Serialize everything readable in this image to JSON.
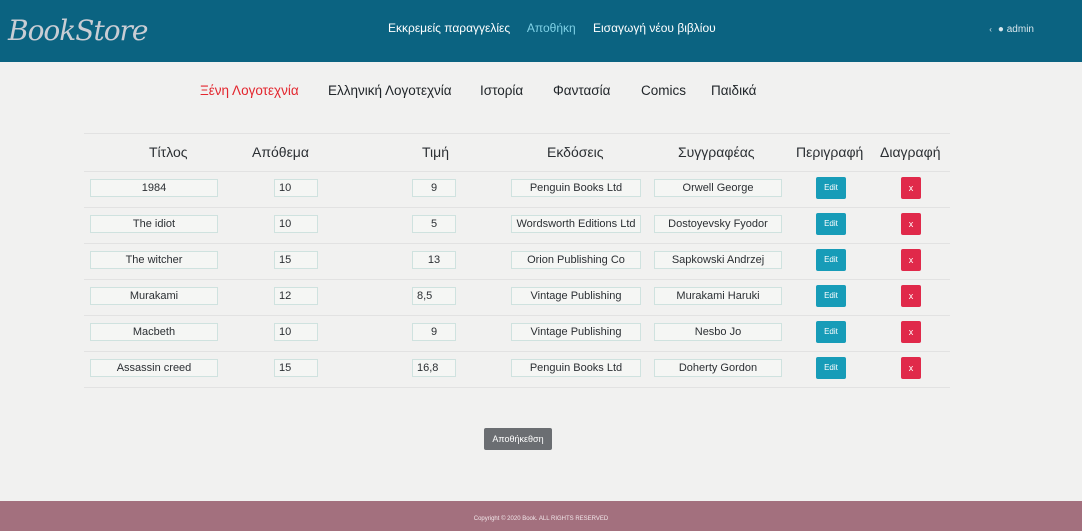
{
  "brand": "BookStore",
  "nav": {
    "links": [
      "Εκκρεμείς παραγγελίες",
      "Αποθήκη",
      "Εισαγωγή νέου βιβλίου"
    ],
    "active_index": 1
  },
  "user": {
    "name": "admin",
    "icon": "user-icon"
  },
  "categories": [
    "Ξένη Λογοτεχνία",
    "Ελληνική Λογοτεχνία",
    "Ιστορία",
    "Φαντασία",
    "Comics",
    "Παιδικά"
  ],
  "colors": {
    "navbar": "#0b6381",
    "active_category": "#e3262e",
    "edit_button": "#179cb8",
    "delete_button": "#e0294a",
    "footer": "#a3707e"
  },
  "table": {
    "headers": [
      "Τίτλος",
      "Απόθεμα",
      "Τιμή",
      "Εκδόσεις",
      "Συγγραφέας",
      "Περιγραφή",
      "Διαγραφή"
    ],
    "rows": [
      [
        "1984",
        "10",
        "9",
        "Penguin Books Ltd",
        "Orwell George"
      ],
      [
        "The idiot",
        "10",
        "5",
        "Wordsworth Editions Ltd",
        "Dostoyevsky Fyodor"
      ],
      [
        "The witcher",
        "15",
        "13",
        "Orion Publishing Co",
        "Sapkowski Andrzej"
      ],
      [
        "Murakami",
        "12",
        "8,5",
        "Vintage Publishing",
        "Murakami Haruki"
      ],
      [
        "Macbeth",
        "10",
        "9",
        "Vintage Publishing",
        "Nesbo Jo"
      ],
      [
        "Assassin creed",
        "15",
        "16,8",
        "Penguin Books Ltd",
        "Doherty Gordon"
      ]
    ],
    "edit_label": "Edit",
    "delete_label": "x"
  },
  "save_label": "Αποθήκεθση",
  "footer": "Copyright © 2020 Book. ALL RIGHTS RESERVED"
}
